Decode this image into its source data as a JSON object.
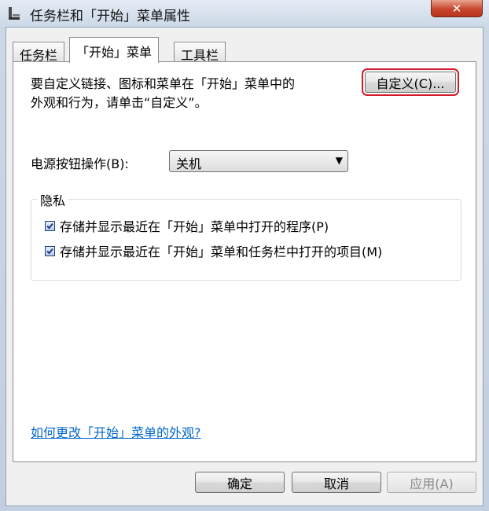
{
  "window": {
    "title": "任务栏和「开始」菜单属性",
    "close_label": "✕"
  },
  "tabs": [
    {
      "label": "任务栏"
    },
    {
      "label": "「开始」菜单"
    },
    {
      "label": "工具栏"
    }
  ],
  "start_menu": {
    "description_line1": "要自定义链接、图标和菜单在「开始」菜单中的",
    "description_line2": "外观和行为，请单击“自定义”。",
    "customize_label": "自定义(C)...",
    "power_label": "电源按钮操作(B):",
    "power_value": "关机",
    "privacy": {
      "title": "隐私",
      "items": [
        {
          "label": "存储并显示最近在「开始」菜单中打开的程序(P)",
          "checked": true
        },
        {
          "label": "存储并显示最近在「开始」菜单和任务栏中打开的项目(M)",
          "checked": true
        }
      ]
    },
    "help_link": "如何更改「开始」菜单的外观?"
  },
  "buttons": {
    "ok": "确定",
    "cancel": "取消",
    "apply": "应用(A)"
  }
}
